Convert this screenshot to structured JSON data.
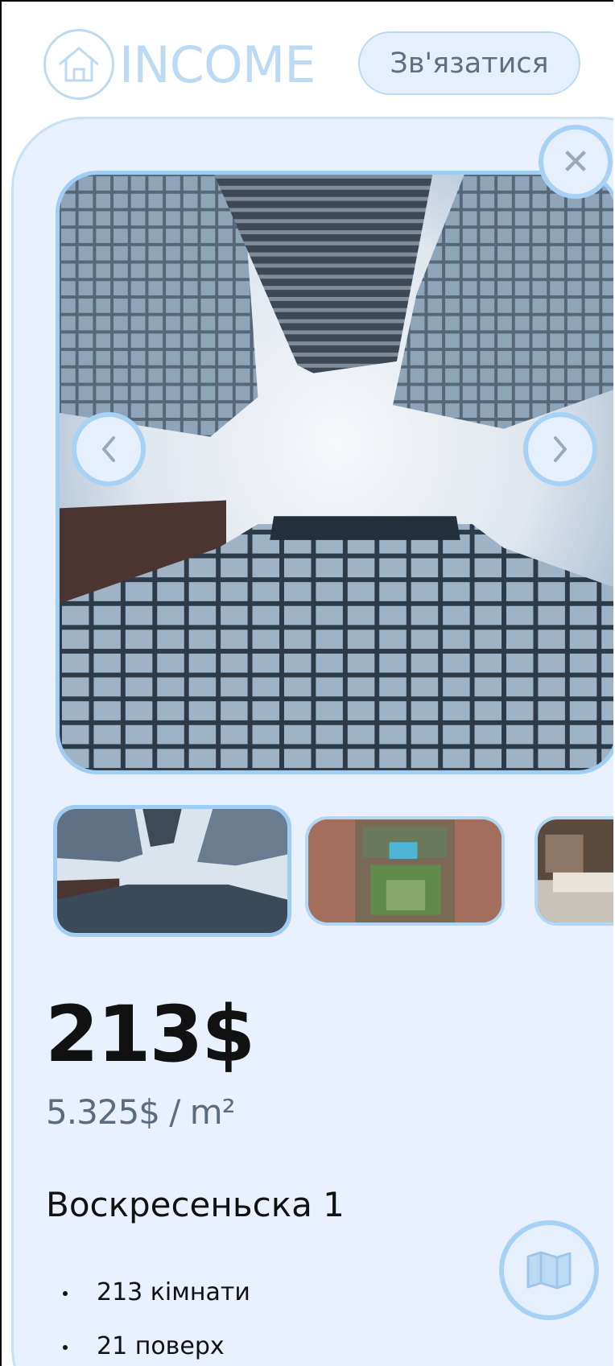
{
  "header": {
    "logo_text": "INCOME",
    "contact_label": "Зв'язатися"
  },
  "gallery": {
    "main_photo": "skyscrapers-looking-up",
    "thumbnails": [
      "skyscrapers-looking-up",
      "aerial-resort-pool",
      "bedroom-interior"
    ],
    "selected_index": 0
  },
  "listing": {
    "price": "213$",
    "price_per_m2": "5.325$ / m²",
    "address": "Воскресеньска 1",
    "features": [
      "213 кімнати",
      "21 поверх"
    ]
  },
  "icons": {
    "close": "close-icon",
    "prev": "chevron-left-icon",
    "next": "chevron-right-icon",
    "map": "map-icon",
    "logo": "house-icon"
  },
  "colors": {
    "accent": "#a7d2f5",
    "card_bg": "#e8f1fd",
    "muted_text": "#5c6b7e"
  }
}
